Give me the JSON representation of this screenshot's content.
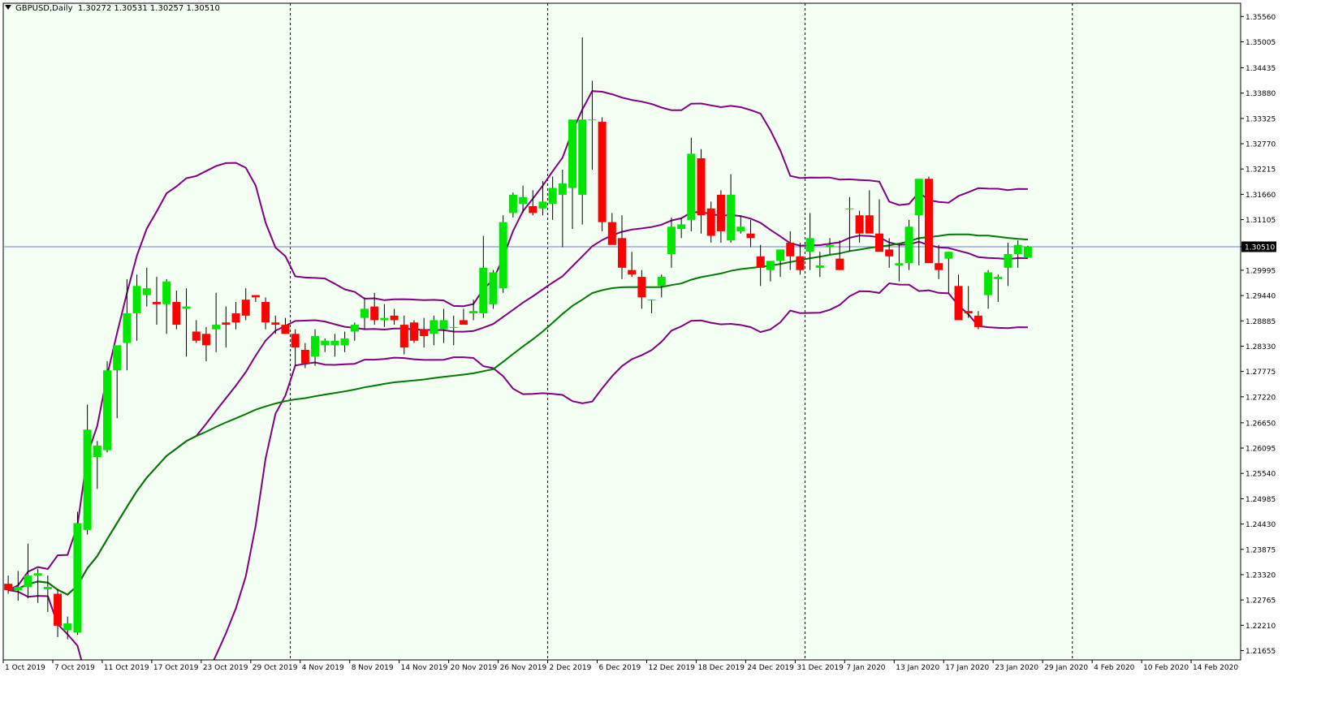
{
  "header": {
    "symbol": "GBPUSD,Daily",
    "ohlc": "1.30272 1.30531 1.30257 1.30510"
  },
  "colors": {
    "background": "#f4fff4",
    "bull": "#00e600",
    "bear": "#ff0000",
    "upper_band": "#800080",
    "lower_band": "#800080",
    "middle_band": "#800080",
    "ma": "#007a00",
    "price_line": "#7a7acc",
    "separator": "#000000"
  },
  "chart_data": {
    "type": "candlestick",
    "symbol": "GBPUSD",
    "timeframe": "Daily",
    "current_price_label": "1.30510",
    "ylim": [
      1.2145,
      1.3585
    ],
    "y_ticks": [
      "1.35560",
      "1.35005",
      "1.34435",
      "1.33880",
      "1.33325",
      "1.32770",
      "1.32215",
      "1.31660",
      "1.31105",
      "1.30510",
      "1.29995",
      "1.29440",
      "1.28885",
      "1.28330",
      "1.27775",
      "1.27220",
      "1.26650",
      "1.26095",
      "1.25540",
      "1.24985",
      "1.24430",
      "1.23875",
      "1.23320",
      "1.22765",
      "1.22210",
      "1.21655"
    ],
    "x_labels": [
      {
        "i": 0,
        "text": "1 Oct 2019"
      },
      {
        "i": 5,
        "text": "7 Oct 2019"
      },
      {
        "i": 10,
        "text": "11 Oct 2019"
      },
      {
        "i": 15,
        "text": "17 Oct 2019"
      },
      {
        "i": 20,
        "text": "23 Oct 2019"
      },
      {
        "i": 25,
        "text": "29 Oct 2019"
      },
      {
        "i": 30,
        "text": "4 Nov 2019"
      },
      {
        "i": 35,
        "text": "8 Nov 2019"
      },
      {
        "i": 40,
        "text": "14 Nov 2019"
      },
      {
        "i": 45,
        "text": "20 Nov 2019"
      },
      {
        "i": 50,
        "text": "26 Nov 2019"
      },
      {
        "i": 55,
        "text": "2 Dec 2019"
      },
      {
        "i": 60,
        "text": "6 Dec 2019"
      },
      {
        "i": 65,
        "text": "12 Dec 2019"
      },
      {
        "i": 70,
        "text": "18 Dec 2019"
      },
      {
        "i": 75,
        "text": "24 Dec 2019"
      },
      {
        "i": 80,
        "text": "31 Dec 2019"
      },
      {
        "i": 85,
        "text": "7 Jan 2020"
      },
      {
        "i": 90,
        "text": "13 Jan 2020"
      },
      {
        "i": 95,
        "text": "17 Jan 2020"
      },
      {
        "i": 100,
        "text": "23 Jan 2020"
      },
      {
        "i": 105,
        "text": "29 Jan 2020"
      },
      {
        "i": 110,
        "text": "4 Feb 2020"
      },
      {
        "i": 115,
        "text": "10 Feb 2020"
      },
      {
        "i": 120,
        "text": "14 Feb 2020"
      }
    ],
    "period_separators": [
      29,
      55,
      81,
      108
    ],
    "ohlc": [
      [
        1.2312,
        1.233,
        1.229,
        1.2298
      ],
      [
        1.2298,
        1.234,
        1.2275,
        1.2305
      ],
      [
        1.2305,
        1.24,
        1.228,
        1.233
      ],
      [
        1.233,
        1.2345,
        1.227,
        1.2335
      ],
      [
        1.23,
        1.233,
        1.225,
        1.2305
      ],
      [
        1.229,
        1.23,
        1.2195,
        1.222
      ],
      [
        1.221,
        1.224,
        1.219,
        1.2225
      ],
      [
        1.2205,
        1.247,
        1.22,
        1.2445
      ],
      [
        1.243,
        1.2705,
        1.242,
        1.265
      ],
      [
        1.259,
        1.2625,
        1.252,
        1.2615
      ],
      [
        1.2605,
        1.28,
        1.26,
        1.278
      ],
      [
        1.278,
        1.283,
        1.2675,
        1.2835
      ],
      [
        1.284,
        1.298,
        1.278,
        1.2905
      ],
      [
        1.2905,
        1.299,
        1.2845,
        1.2965
      ],
      [
        1.2945,
        1.3005,
        1.292,
        1.296
      ],
      [
        1.293,
        1.2985,
        1.288,
        1.2925
      ],
      [
        1.2925,
        1.298,
        1.286,
        1.2975
      ],
      [
        1.293,
        1.2955,
        1.287,
        1.288
      ],
      [
        1.2915,
        1.296,
        1.281,
        1.292
      ],
      [
        1.2865,
        1.289,
        1.284,
        1.2845
      ],
      [
        1.286,
        1.2875,
        1.28,
        1.2835
      ],
      [
        1.287,
        1.295,
        1.282,
        1.288
      ],
      [
        1.2885,
        1.292,
        1.283,
        1.288
      ],
      [
        1.2905,
        1.293,
        1.287,
        1.2885
      ],
      [
        1.2935,
        1.296,
        1.289,
        1.29
      ],
      [
        1.2945,
        1.2945,
        1.293,
        1.294
      ],
      [
        1.293,
        1.294,
        1.287,
        1.2885
      ],
      [
        1.2885,
        1.29,
        1.286,
        1.288
      ],
      [
        1.288,
        1.2895,
        1.286,
        1.286
      ],
      [
        1.286,
        1.287,
        1.279,
        1.283
      ],
      [
        1.2825,
        1.284,
        1.2785,
        1.2795
      ],
      [
        1.281,
        1.287,
        1.279,
        1.2855
      ],
      [
        1.2835,
        1.285,
        1.282,
        1.2845
      ],
      [
        1.2835,
        1.286,
        1.281,
        1.2845
      ],
      [
        1.2835,
        1.2865,
        1.282,
        1.285
      ],
      [
        1.2865,
        1.2885,
        1.2845,
        1.288
      ],
      [
        1.2895,
        1.294,
        1.287,
        1.2915
      ],
      [
        1.292,
        1.295,
        1.288,
        1.289
      ],
      [
        1.289,
        1.2925,
        1.2875,
        1.2895
      ],
      [
        1.29,
        1.2915,
        1.288,
        1.289
      ],
      [
        1.288,
        1.29,
        1.2815,
        1.283
      ],
      [
        1.2885,
        1.289,
        1.284,
        1.2845
      ],
      [
        1.287,
        1.2895,
        1.283,
        1.2855
      ],
      [
        1.286,
        1.29,
        1.2835,
        1.289
      ],
      [
        1.287,
        1.2915,
        1.284,
        1.289
      ],
      [
        1.2875,
        1.29,
        1.2835,
        1.2875
      ],
      [
        1.289,
        1.2915,
        1.288,
        1.288
      ],
      [
        1.2905,
        1.2935,
        1.289,
        1.291
      ],
      [
        1.2905,
        1.3075,
        1.2895,
        1.3005
      ],
      [
        1.2925,
        1.3,
        1.2915,
        1.2995
      ],
      [
        1.296,
        1.312,
        1.295,
        1.3105
      ],
      [
        1.3125,
        1.317,
        1.3115,
        1.3165
      ],
      [
        1.3145,
        1.3185,
        1.3125,
        1.316
      ],
      [
        1.314,
        1.3175,
        1.312,
        1.3125
      ],
      [
        1.3135,
        1.3195,
        1.312,
        1.315
      ],
      [
        1.3145,
        1.3205,
        1.311,
        1.318
      ],
      [
        1.3165,
        1.322,
        1.305,
        1.319
      ],
      [
        1.318,
        1.33,
        1.309,
        1.333
      ],
      [
        1.3165,
        1.351,
        1.31,
        1.333
      ],
      [
        1.333,
        1.3415,
        1.322,
        1.333
      ],
      [
        1.3325,
        1.3335,
        1.3085,
        1.3105
      ],
      [
        1.3105,
        1.3125,
        1.3065,
        1.3055
      ],
      [
        1.307,
        1.312,
        1.298,
        1.3005
      ],
      [
        1.3,
        1.304,
        1.2985,
        1.299
      ],
      [
        1.2985,
        1.3,
        1.2915,
        1.294
      ],
      [
        1.2935,
        1.2935,
        1.2905,
        1.2935
      ],
      [
        1.2965,
        1.299,
        1.294,
        1.2985
      ],
      [
        1.3035,
        1.3115,
        1.3005,
        1.3095
      ],
      [
        1.309,
        1.3115,
        1.307,
        1.31
      ],
      [
        1.311,
        1.329,
        1.3085,
        1.3255
      ],
      [
        1.3245,
        1.3265,
        1.308,
        1.312
      ],
      [
        1.3135,
        1.315,
        1.306,
        1.3075
      ],
      [
        1.3165,
        1.3175,
        1.306,
        1.3085
      ],
      [
        1.3065,
        1.321,
        1.306,
        1.3165
      ],
      [
        1.3085,
        1.312,
        1.308,
        1.3095
      ],
      [
        1.308,
        1.311,
        1.305,
        1.307
      ],
      [
        1.303,
        1.3055,
        1.2965,
        1.3005
      ],
      [
        1.3,
        1.302,
        1.2975,
        1.302
      ],
      [
        1.302,
        1.3045,
        1.2985,
        1.3045
      ],
      [
        1.306,
        1.3085,
        1.3,
        1.303
      ],
      [
        1.303,
        1.306,
        1.299,
        1.3
      ],
      [
        1.304,
        1.3125,
        1.3,
        1.307
      ],
      [
        1.3005,
        1.304,
        1.2985,
        1.301
      ],
      [
        1.305,
        1.307,
        1.3035,
        1.3055
      ],
      [
        1.3025,
        1.3065,
        1.3,
        1.3
      ],
      [
        1.3135,
        1.316,
        1.304,
        1.3135
      ],
      [
        1.312,
        1.313,
        1.306,
        1.308
      ],
      [
        1.312,
        1.3175,
        1.309,
        1.308
      ],
      [
        1.308,
        1.3155,
        1.3045,
        1.304
      ],
      [
        1.3045,
        1.307,
        1.3005,
        1.303
      ],
      [
        1.301,
        1.3055,
        1.2975,
        1.3015
      ],
      [
        1.3015,
        1.311,
        1.3,
        1.3095
      ],
      [
        1.312,
        1.315,
        1.301,
        1.32
      ],
      [
        1.32,
        1.3205,
        1.308,
        1.3015
      ],
      [
        1.3015,
        1.3055,
        1.298,
        1.3
      ],
      [
        1.3025,
        1.304,
        1.295,
        1.304
      ],
      [
        1.2965,
        1.299,
        1.2925,
        1.289
      ],
      [
        1.291,
        1.2965,
        1.2895,
        1.2905
      ],
      [
        1.29,
        1.291,
        1.287,
        1.2875
      ],
      [
        1.2945,
        1.3,
        1.2915,
        1.2995
      ],
      [
        1.298,
        1.299,
        1.293,
        1.2985
      ],
      [
        1.3005,
        1.306,
        1.2965,
        1.3035
      ],
      [
        1.3035,
        1.3065,
        1.3005,
        1.3055
      ],
      [
        1.3027,
        1.3053,
        1.3026,
        1.3051
      ]
    ],
    "indicators": [
      {
        "name": "bollinger_upper",
        "color": "#800080",
        "points": []
      },
      {
        "name": "bollinger_middle",
        "color": "#800080",
        "points": []
      },
      {
        "name": "bollinger_lower",
        "color": "#800080",
        "points": []
      },
      {
        "name": "moving_average",
        "color": "#007a00",
        "points": []
      }
    ],
    "title": "",
    "xlabel": "",
    "ylabel": "",
    "grid": false
  }
}
